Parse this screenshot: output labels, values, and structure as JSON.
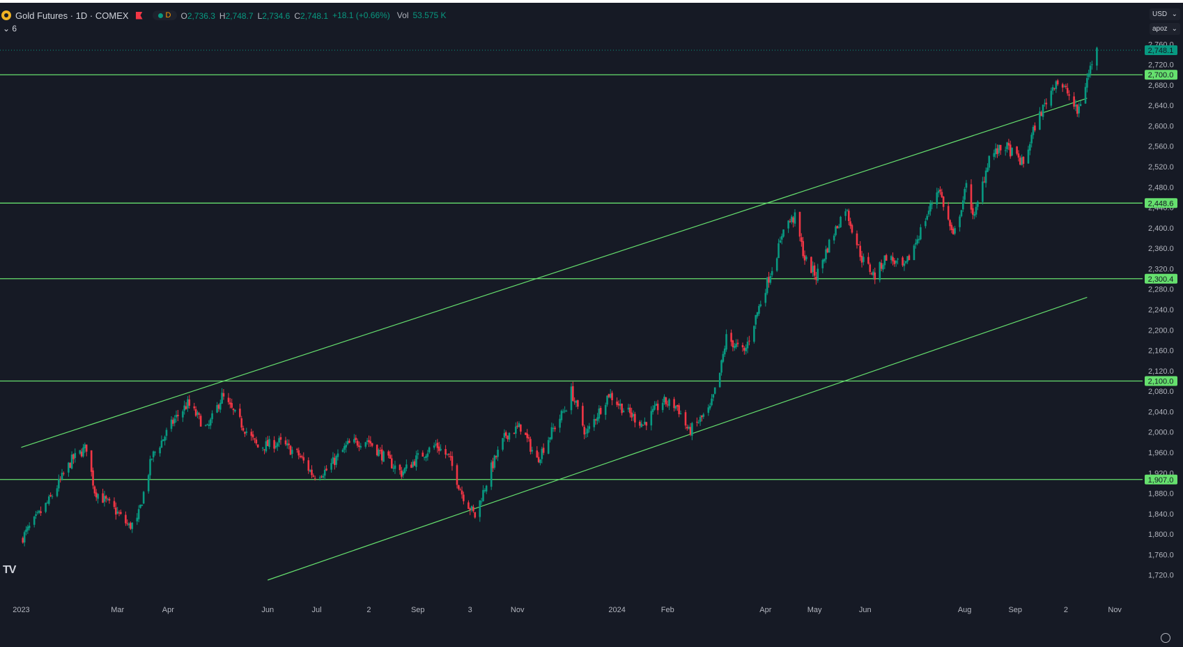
{
  "header": {
    "title": "Gold Futures · 1D · COMEX",
    "interval_badge": "D",
    "ohlc": [
      {
        "label": "O",
        "value": "2,736.3"
      },
      {
        "label": "H",
        "value": "2,748.7"
      },
      {
        "label": "L",
        "value": "2,734.6"
      },
      {
        "label": "C",
        "value": "2,748.1"
      }
    ],
    "change": "+18.1 (+0.66%)",
    "vol_label": "Vol",
    "vol_value": "53.575 K",
    "indicator_toggle": "⌄ 6"
  },
  "controls": {
    "currency": "USD",
    "scale": "apoz"
  },
  "watermark": "TV",
  "colors": {
    "up": "#089981",
    "down": "#f23645",
    "level": "#66e06e",
    "background": "#161a25"
  },
  "chart_data": {
    "type": "candlestick",
    "x_labels": [
      "2023",
      "Mar",
      "Apr",
      "Jun",
      "Jul",
      "2",
      "Sep",
      "3",
      "Nov",
      "2024",
      "Feb",
      "Apr",
      "May",
      "Jun",
      "Aug",
      "Sep",
      "2",
      "Nov"
    ],
    "y_ticks": [
      1720,
      1760,
      1800,
      1840,
      1880,
      1920,
      1960,
      2000,
      2040,
      2080,
      2120,
      2160,
      2200,
      2240,
      2280,
      2320,
      2360,
      2400,
      2440,
      2480,
      2520,
      2560,
      2600,
      2640,
      2680,
      2720,
      2760
    ],
    "ylim": [
      1710,
      2770
    ],
    "last_price": 2748.1,
    "horizontal_levels": [
      {
        "value": 2700.0,
        "label": "2,700.0"
      },
      {
        "value": 2448.6,
        "label": "2,448.6"
      },
      {
        "value": 2300.4,
        "label": "2,300.4"
      },
      {
        "value": 2100.0,
        "label": "2,100.0"
      },
      {
        "value": 1907.0,
        "label": "1,907.0"
      }
    ],
    "last_price_label": "2,748.1",
    "trendlines": [
      {
        "points": [
          [
            "2023-01-01",
            1970
          ],
          [
            "2024-10-15",
            2654
          ]
        ]
      },
      {
        "points": [
          [
            "2023-06-01",
            1710
          ],
          [
            "2024-10-15",
            2264
          ]
        ]
      }
    ],
    "price_path": [
      [
        "2023-01-01",
        1790
      ],
      [
        "2023-01-18",
        1865
      ],
      [
        "2023-02-01",
        1945
      ],
      [
        "2023-02-10",
        1970
      ],
      [
        "2023-02-15",
        1885
      ],
      [
        "2023-02-28",
        1845
      ],
      [
        "2023-03-08",
        1815
      ],
      [
        "2023-03-13",
        1825
      ],
      [
        "2023-03-22",
        1950
      ],
      [
        "2023-04-05",
        2025
      ],
      [
        "2023-04-13",
        2055
      ],
      [
        "2023-04-25",
        2005
      ],
      [
        "2023-05-04",
        2070
      ],
      [
        "2023-05-15",
        2020
      ],
      [
        "2023-05-26",
        1970
      ],
      [
        "2023-06-08",
        1980
      ],
      [
        "2023-06-20",
        1955
      ],
      [
        "2023-06-29",
        1915
      ],
      [
        "2023-07-07",
        1925
      ],
      [
        "2023-07-20",
        1975
      ],
      [
        "2023-08-01",
        1985
      ],
      [
        "2023-08-10",
        1955
      ],
      [
        "2023-08-22",
        1920
      ],
      [
        "2023-09-01",
        1950
      ],
      [
        "2023-09-12",
        1975
      ],
      [
        "2023-09-20",
        1950
      ],
      [
        "2023-09-28",
        1880
      ],
      [
        "2023-10-06",
        1835
      ],
      [
        "2023-10-16",
        1930
      ],
      [
        "2023-10-25",
        1995
      ],
      [
        "2023-11-03",
        2010
      ],
      [
        "2023-11-13",
        1945
      ],
      [
        "2023-11-22",
        2000
      ],
      [
        "2023-12-01",
        2050
      ],
      [
        "2023-12-04",
        2080
      ],
      [
        "2023-12-13",
        1995
      ],
      [
        "2023-12-27",
        2075
      ],
      [
        "2024-01-05",
        2045
      ],
      [
        "2024-01-17",
        2015
      ],
      [
        "2024-01-29",
        2060
      ],
      [
        "2024-02-07",
        2050
      ],
      [
        "2024-02-14",
        2000
      ],
      [
        "2024-02-27",
        2045
      ],
      [
        "2024-03-04",
        2115
      ],
      [
        "2024-03-08",
        2185
      ],
      [
        "2024-03-19",
        2155
      ],
      [
        "2024-03-28",
        2245
      ],
      [
        "2024-04-10",
        2370
      ],
      [
        "2024-04-12",
        2405
      ],
      [
        "2024-04-19",
        2420
      ],
      [
        "2024-04-25",
        2340
      ],
      [
        "2024-05-02",
        2305
      ],
      [
        "2024-05-10",
        2370
      ],
      [
        "2024-05-20",
        2440
      ],
      [
        "2024-05-30",
        2340
      ],
      [
        "2024-06-07",
        2305
      ],
      [
        "2024-06-14",
        2345
      ],
      [
        "2024-06-25",
        2320
      ],
      [
        "2024-07-05",
        2395
      ],
      [
        "2024-07-16",
        2480
      ],
      [
        "2024-07-25",
        2380
      ],
      [
        "2024-08-02",
        2480
      ],
      [
        "2024-08-07",
        2420
      ],
      [
        "2024-08-16",
        2540
      ],
      [
        "2024-08-26",
        2560
      ],
      [
        "2024-09-06",
        2525
      ],
      [
        "2024-09-13",
        2600
      ],
      [
        "2024-09-26",
        2690
      ],
      [
        "2024-10-03",
        2665
      ],
      [
        "2024-10-09",
        2625
      ],
      [
        "2024-10-18",
        2725
      ],
      [
        "2024-10-21",
        2748.1
      ]
    ]
  }
}
